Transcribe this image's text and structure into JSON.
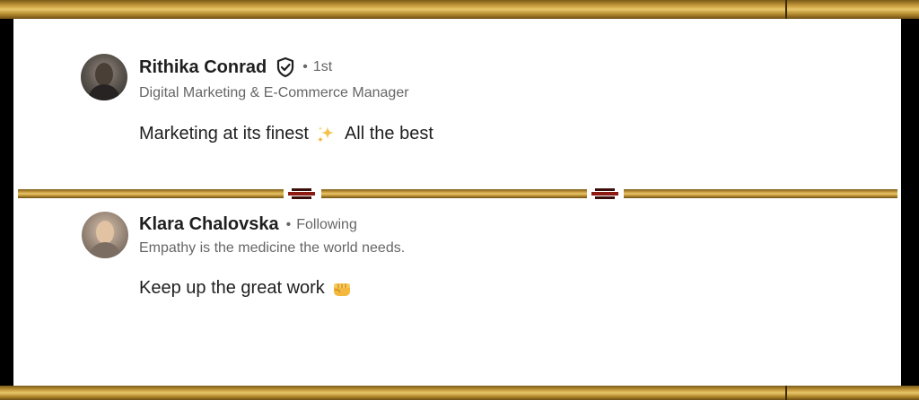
{
  "comments": [
    {
      "author": "Rithika Conrad",
      "degree": "1st",
      "headline": "Digital Marketing & E-Commerce Manager",
      "text_before": "Marketing at its finest",
      "emoji": "sparkles-icon",
      "text_after": "All the best"
    },
    {
      "author": "Klara Chalovska",
      "relation": "Following",
      "headline": "Empathy is the medicine the world needs.",
      "text": "Keep up the great work",
      "emoji": "fist-bump-icon"
    }
  ],
  "colors": {
    "gold": "#c79a3c",
    "name": "#1f1f1f",
    "meta": "#666666"
  }
}
